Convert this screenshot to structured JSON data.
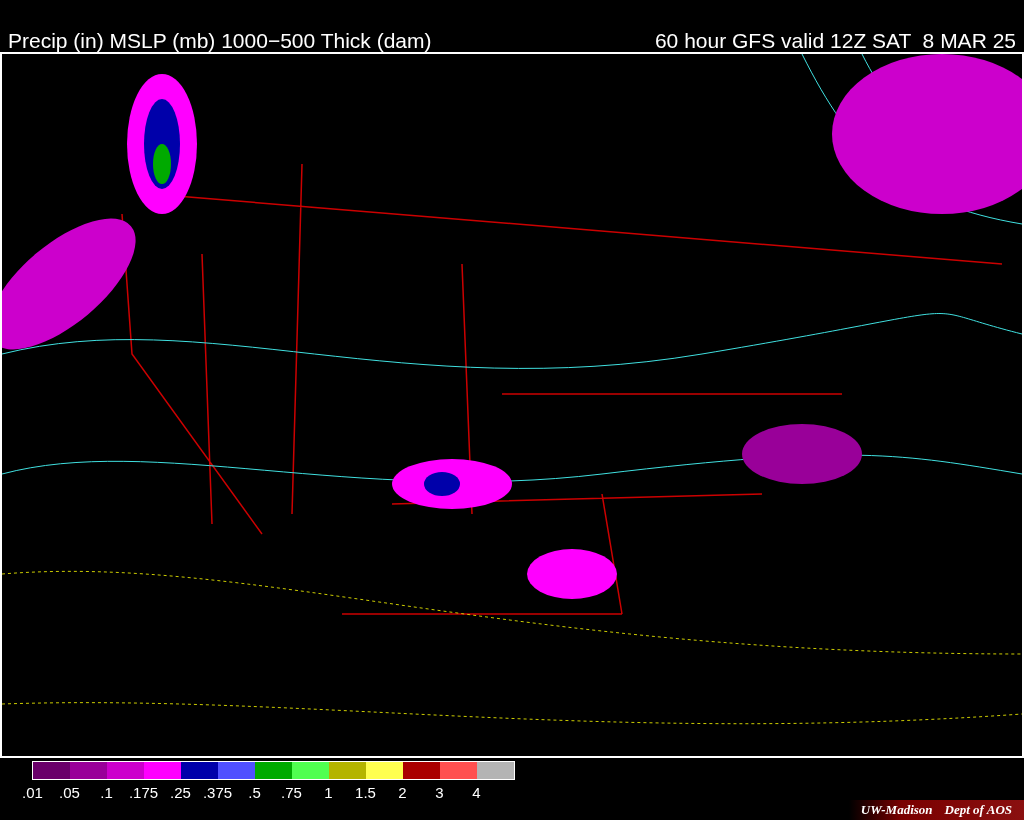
{
  "header": {
    "title": "Precip (in) MSLP (mb) 1000−500 Thick (dam)",
    "valid": "60 hour GFS valid 12Z SAT  8 MAR 25"
  },
  "legend": [
    {
      "label": ".01",
      "color": "#6a006a"
    },
    {
      "label": ".05",
      "color": "#990099"
    },
    {
      "label": ".1",
      "color": "#cc00cc"
    },
    {
      "label": ".175",
      "color": "#ff00ff"
    },
    {
      "label": ".25",
      "color": "#0000aa"
    },
    {
      "label": ".375",
      "color": "#5050ff"
    },
    {
      "label": ".5",
      "color": "#00aa00"
    },
    {
      "label": ".75",
      "color": "#50ff50"
    },
    {
      "label": "1",
      "color": "#b4b400"
    },
    {
      "label": "1.5",
      "color": "#ffff50"
    },
    {
      "label": "2",
      "color": "#aa0000"
    },
    {
      "label": "3",
      "color": "#ff5050"
    },
    {
      "label": "4",
      "color": "#b4b4b4"
    }
  ],
  "credits": [
    "UW-Madison",
    "Dept of AOS"
  ]
}
